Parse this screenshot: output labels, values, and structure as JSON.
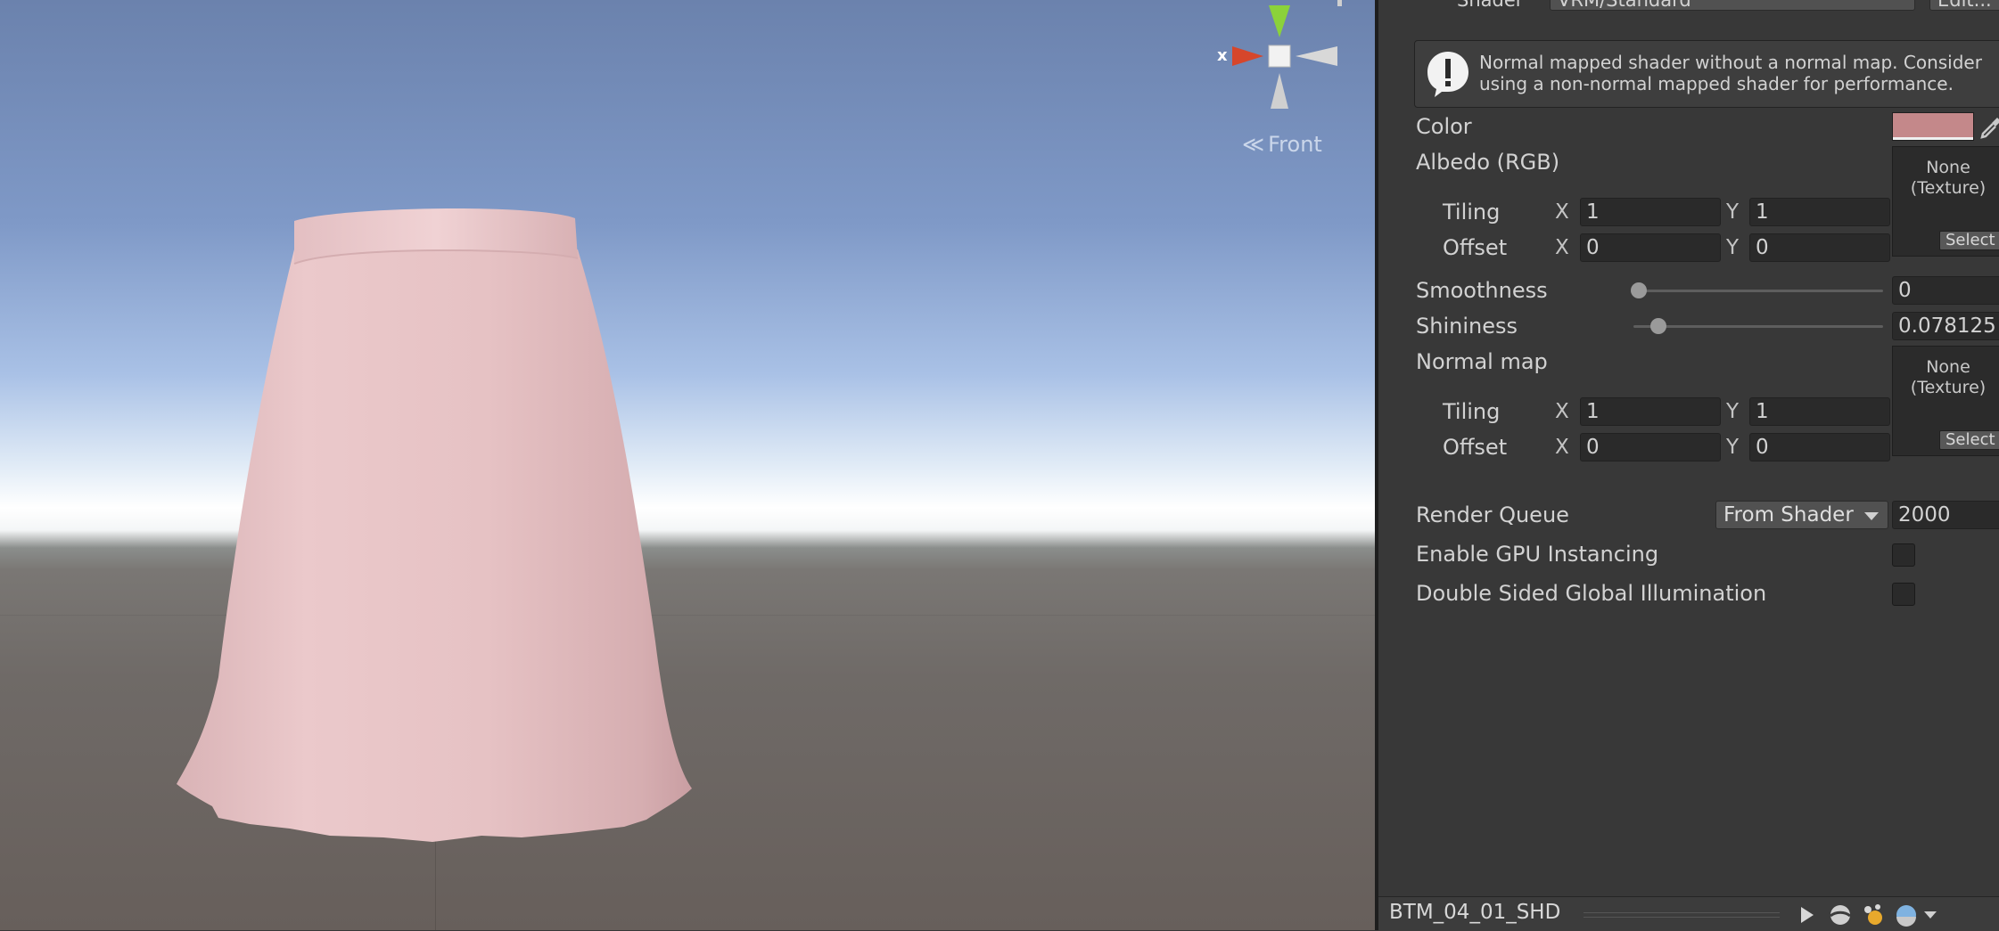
{
  "scene": {
    "orientation_label": "Front",
    "gizmo_axis_label": "x",
    "skirt_color": "#e8c4c6"
  },
  "inspector": {
    "shader": {
      "label": "Shader",
      "value": "VRM/Standard",
      "edit_button": "Edit..."
    },
    "warning": {
      "text": "Normal mapped shader without a normal map. Consider using a non-normal mapped shader for performance."
    },
    "color": {
      "label": "Color",
      "value": "#c4888a"
    },
    "albedo": {
      "label": "Albedo (RGB)",
      "texture": "None\n(Texture)",
      "select": "Select",
      "tiling_label": "Tiling",
      "tiling_x": "1",
      "tiling_y": "1",
      "offset_label": "Offset",
      "offset_x": "0",
      "offset_y": "0"
    },
    "smoothness": {
      "label": "Smoothness",
      "value": "0",
      "fraction": 0.0
    },
    "shininess": {
      "label": "Shininess",
      "value": "0.078125",
      "fraction": 0.078125
    },
    "normal_map": {
      "label": "Normal map",
      "texture": "None\n(Texture)",
      "select": "Select",
      "tiling_label": "Tiling",
      "tiling_x": "1",
      "tiling_y": "1",
      "offset_label": "Offset",
      "offset_x": "0",
      "offset_y": "0"
    },
    "axis_x": "X",
    "axis_y": "Y",
    "render_queue": {
      "label": "Render Queue",
      "mode": "From Shader",
      "value": "2000"
    },
    "gpu_instancing": {
      "label": "Enable GPU Instancing",
      "checked": false
    },
    "double_sided_gi": {
      "label": "Double Sided Global Illumination",
      "checked": false
    },
    "preview_bar": {
      "asset_name": "BTM_04_01_SHD"
    }
  }
}
